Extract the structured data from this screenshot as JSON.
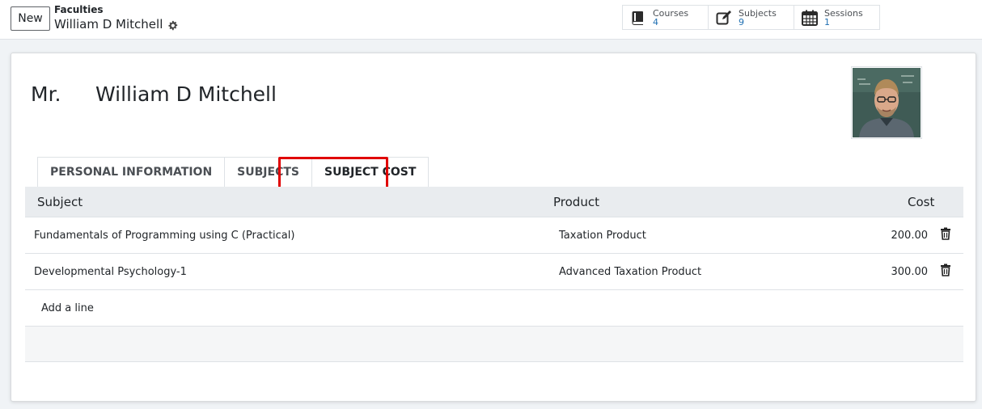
{
  "control_panel": {
    "new_label": "New",
    "breadcrumb_parent": "Faculties",
    "breadcrumb_current": "William D Mitchell",
    "smart_buttons": [
      {
        "label": "Courses",
        "value": "4",
        "icon": "book-icon"
      },
      {
        "label": "Subjects",
        "value": "9",
        "icon": "edit-icon"
      },
      {
        "label": "Sessions",
        "value": "1",
        "icon": "calendar-icon"
      }
    ]
  },
  "record": {
    "title_prefix": "Mr.",
    "name": "William D Mitchell",
    "avatar": "faculty-photo"
  },
  "tabs": [
    {
      "label": "PERSONAL INFORMATION"
    },
    {
      "label": "SUBJECTS"
    },
    {
      "label": "SUBJECT COST",
      "active": true
    }
  ],
  "table": {
    "headers": {
      "subject": "Subject",
      "product": "Product",
      "cost": "Cost"
    },
    "rows": [
      {
        "subject": "Fundamentals of Programming using C (Practical)",
        "product": "Taxation Product",
        "cost": "200.00"
      },
      {
        "subject": "Developmental Psychology-1",
        "product": "Advanced Taxation Product",
        "cost": "300.00"
      }
    ],
    "add_line_label": "Add a line"
  },
  "colors": {
    "highlight": "#e00000",
    "header_bg": "#e9ecef",
    "link": "#1f6fb2"
  }
}
